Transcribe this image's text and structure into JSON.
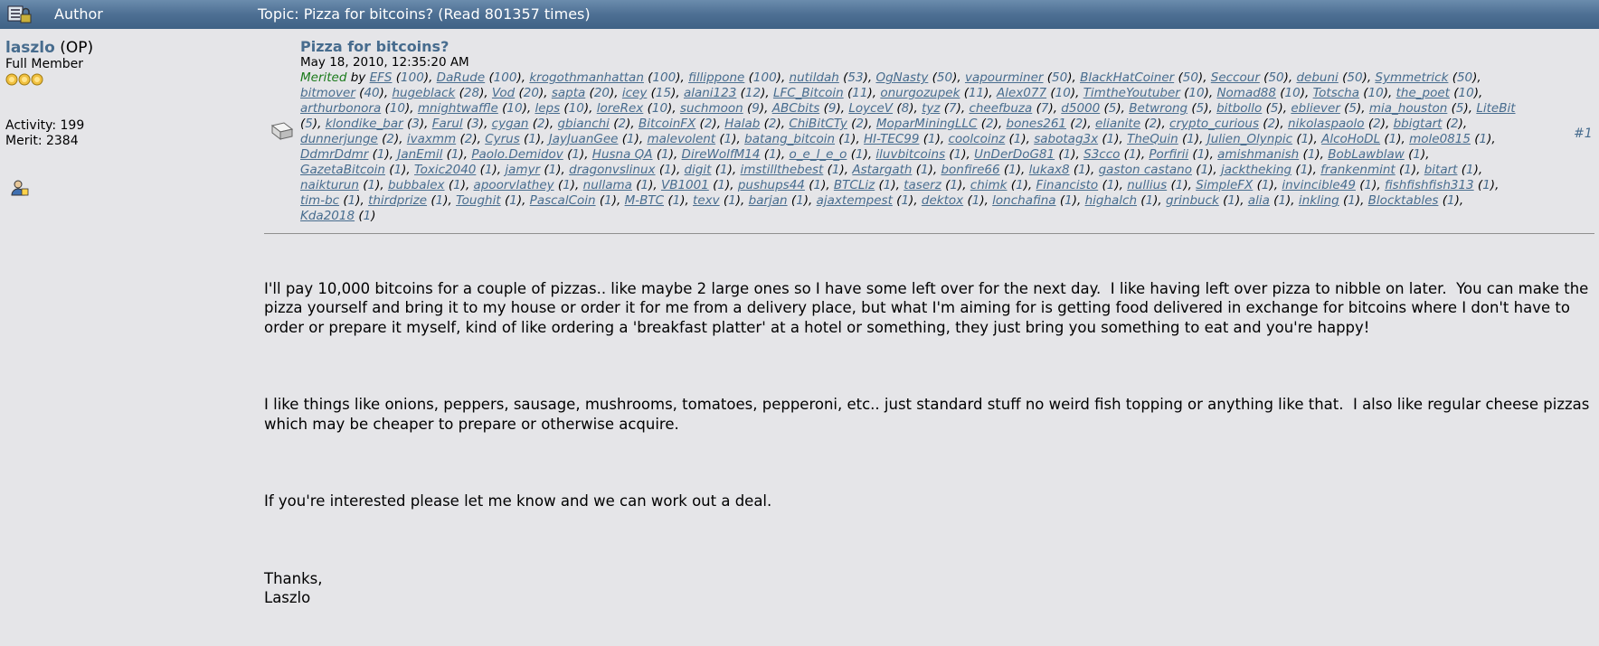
{
  "header": {
    "author_label": "Author",
    "topic_text": "Topic: Pizza for bitcoins?  (Read 801357 times)"
  },
  "user": {
    "name": "laszlo",
    "op_label": "(OP)",
    "rank": "Full Member",
    "activity": "Activity: 199",
    "merit": "Merit: 2384"
  },
  "post": {
    "title": "Pizza for bitcoins?",
    "date": "May 18, 2010, 12:35:20 AM",
    "merited_label": "Merited",
    "by_label": " by ",
    "post_number": "#1",
    "merits": [
      {
        "user": "EFS",
        "count": "100"
      },
      {
        "user": "DaRude",
        "count": "100"
      },
      {
        "user": "krogothmanhattan",
        "count": "100"
      },
      {
        "user": "fillippone",
        "count": "100"
      },
      {
        "user": "nutildah",
        "count": "53"
      },
      {
        "user": "OgNasty",
        "count": "50"
      },
      {
        "user": "vapourminer",
        "count": "50"
      },
      {
        "user": "BlackHatCoiner",
        "count": "50"
      },
      {
        "user": "Seccour",
        "count": "50"
      },
      {
        "user": "debuni",
        "count": "50"
      },
      {
        "user": "Symmetrick",
        "count": "50"
      },
      {
        "user": "bitmover",
        "count": "40"
      },
      {
        "user": "hugeblack",
        "count": "28"
      },
      {
        "user": "Vod",
        "count": "20"
      },
      {
        "user": "sapta",
        "count": "20"
      },
      {
        "user": "icey",
        "count": "15"
      },
      {
        "user": "alani123",
        "count": "12"
      },
      {
        "user": "LFC_Bitcoin",
        "count": "11"
      },
      {
        "user": "onurgozupek",
        "count": "11"
      },
      {
        "user": "Alex077",
        "count": "10"
      },
      {
        "user": "TimtheYoutuber",
        "count": "10"
      },
      {
        "user": "Nomad88",
        "count": "10"
      },
      {
        "user": "Totscha",
        "count": "10"
      },
      {
        "user": "the_poet",
        "count": "10"
      },
      {
        "user": "arthurbonora",
        "count": "10"
      },
      {
        "user": "mnightwaffle",
        "count": "10"
      },
      {
        "user": "leps",
        "count": "10"
      },
      {
        "user": "loreRex",
        "count": "10"
      },
      {
        "user": "suchmoon",
        "count": "9"
      },
      {
        "user": "ABCbits",
        "count": "9"
      },
      {
        "user": "LoyceV",
        "count": "8"
      },
      {
        "user": "tyz",
        "count": "7"
      },
      {
        "user": "cheefbuza",
        "count": "7"
      },
      {
        "user": "d5000",
        "count": "5"
      },
      {
        "user": "Betwrong",
        "count": "5"
      },
      {
        "user": "bitbollo",
        "count": "5"
      },
      {
        "user": "ebliever",
        "count": "5"
      },
      {
        "user": "mia_houston",
        "count": "5"
      },
      {
        "user": "LiteBit",
        "count": "5"
      },
      {
        "user": "klondike_bar",
        "count": "3"
      },
      {
        "user": "Farul",
        "count": "3"
      },
      {
        "user": "cygan",
        "count": "2"
      },
      {
        "user": "gbianchi",
        "count": "2"
      },
      {
        "user": "BitcoinFX",
        "count": "2"
      },
      {
        "user": "Halab",
        "count": "2"
      },
      {
        "user": "ChiBitCTy",
        "count": "2"
      },
      {
        "user": "MoparMiningLLC",
        "count": "2"
      },
      {
        "user": "bones261",
        "count": "2"
      },
      {
        "user": "elianite",
        "count": "2"
      },
      {
        "user": "crypto_curious",
        "count": "2"
      },
      {
        "user": "nikolaspaolo",
        "count": "2"
      },
      {
        "user": "bbigtart",
        "count": "2"
      },
      {
        "user": "dunnerjunge",
        "count": "2"
      },
      {
        "user": "ivaxmm",
        "count": "2"
      },
      {
        "user": "Cyrus",
        "count": "1"
      },
      {
        "user": "JayJuanGee",
        "count": "1"
      },
      {
        "user": "malevolent",
        "count": "1"
      },
      {
        "user": "batang_bitcoin",
        "count": "1"
      },
      {
        "user": "HI-TEC99",
        "count": "1"
      },
      {
        "user": "coolcoinz",
        "count": "1"
      },
      {
        "user": "sabotag3x",
        "count": "1"
      },
      {
        "user": "TheQuin",
        "count": "1"
      },
      {
        "user": "Julien_Olynpic",
        "count": "1"
      },
      {
        "user": "AlcoHoDL",
        "count": "1"
      },
      {
        "user": "mole0815",
        "count": "1"
      },
      {
        "user": "DdmrDdmr",
        "count": "1"
      },
      {
        "user": "JanEmil",
        "count": "1"
      },
      {
        "user": "Paolo.Demidov",
        "count": "1"
      },
      {
        "user": "Husna QA",
        "count": "1"
      },
      {
        "user": "DireWolfM14",
        "count": "1"
      },
      {
        "user": "o_e_l_e_o",
        "count": "1"
      },
      {
        "user": "iluvbitcoins",
        "count": "1"
      },
      {
        "user": "UnDerDoG81",
        "count": "1"
      },
      {
        "user": "S3cco",
        "count": "1"
      },
      {
        "user": "Porfirii",
        "count": "1"
      },
      {
        "user": "amishmanish",
        "count": "1"
      },
      {
        "user": "BobLawblaw",
        "count": "1"
      },
      {
        "user": "GazetaBitcoin",
        "count": "1"
      },
      {
        "user": "Toxic2040",
        "count": "1"
      },
      {
        "user": "jamyr",
        "count": "1"
      },
      {
        "user": "dragonvslinux",
        "count": "1"
      },
      {
        "user": "digit",
        "count": "1"
      },
      {
        "user": "imstillthebest",
        "count": "1"
      },
      {
        "user": "Astargath",
        "count": "1"
      },
      {
        "user": "bonfire66",
        "count": "1"
      },
      {
        "user": "lukax8",
        "count": "1"
      },
      {
        "user": "gaston castano",
        "count": "1"
      },
      {
        "user": "jacktheking",
        "count": "1"
      },
      {
        "user": "frankenmint",
        "count": "1"
      },
      {
        "user": "bitart",
        "count": "1"
      },
      {
        "user": "naikturun",
        "count": "1"
      },
      {
        "user": "bubbalex",
        "count": "1"
      },
      {
        "user": "apoorvlathey",
        "count": "1"
      },
      {
        "user": "nullama",
        "count": "1"
      },
      {
        "user": "VB1001",
        "count": "1"
      },
      {
        "user": "pushups44",
        "count": "1"
      },
      {
        "user": "BTCLiz",
        "count": "1"
      },
      {
        "user": "taserz",
        "count": "1"
      },
      {
        "user": "chimk",
        "count": "1"
      },
      {
        "user": "Financisto",
        "count": "1"
      },
      {
        "user": "nullius",
        "count": "1"
      },
      {
        "user": "SimpleFX",
        "count": "1"
      },
      {
        "user": "invincible49",
        "count": "1"
      },
      {
        "user": "fishfishfish313",
        "count": "1"
      },
      {
        "user": "tim-bc",
        "count": "1"
      },
      {
        "user": "thirdprize",
        "count": "1"
      },
      {
        "user": "Toughit",
        "count": "1"
      },
      {
        "user": "PascalCoin",
        "count": "1"
      },
      {
        "user": "M-BTC",
        "count": "1"
      },
      {
        "user": "texv",
        "count": "1"
      },
      {
        "user": "barjan",
        "count": "1"
      },
      {
        "user": "ajaxtempest",
        "count": "1"
      },
      {
        "user": "dektox",
        "count": "1"
      },
      {
        "user": "lonchafina",
        "count": "1"
      },
      {
        "user": "highalch",
        "count": "1"
      },
      {
        "user": "grinbuck",
        "count": "1"
      },
      {
        "user": "alia",
        "count": "1"
      },
      {
        "user": "inkling",
        "count": "1"
      },
      {
        "user": "Blocktables",
        "count": "1"
      },
      {
        "user": "Kda2018",
        "count": "1"
      }
    ],
    "body": {
      "p1": "I'll pay 10,000 bitcoins for a couple of pizzas.. like maybe 2 large ones so I have some left over for the next day.  I like having left over pizza to nibble on later.  You can make the pizza yourself and bring it to my house or order it for me from a delivery place, but what I'm aiming for is getting food delivered in exchange for bitcoins where I don't have to order or prepare it myself, kind of like ordering a 'breakfast platter' at a hotel or something, they just bring you something to eat and you're happy!",
      "p2": "I like things like onions, peppers, sausage, mushrooms, tomatoes, pepperoni, etc.. just standard stuff no weird fish topping or anything like that.  I also like regular cheese pizzas which may be cheaper to prepare or otherwise acquire.",
      "p3": "If you're interested please let me know and we can work out a deal.",
      "p4": "Thanks,\nLaszlo"
    }
  },
  "colors": {
    "header_bg": "#4d6f93",
    "page_bg": "#e5e5e8",
    "link": "#476c8e",
    "merited": "#1a7a1a"
  },
  "icons": {
    "header_icon": "lock-icon",
    "profile_icon": "profile-icon",
    "post_icon": "message-icon",
    "star_icon": "star-icon"
  }
}
